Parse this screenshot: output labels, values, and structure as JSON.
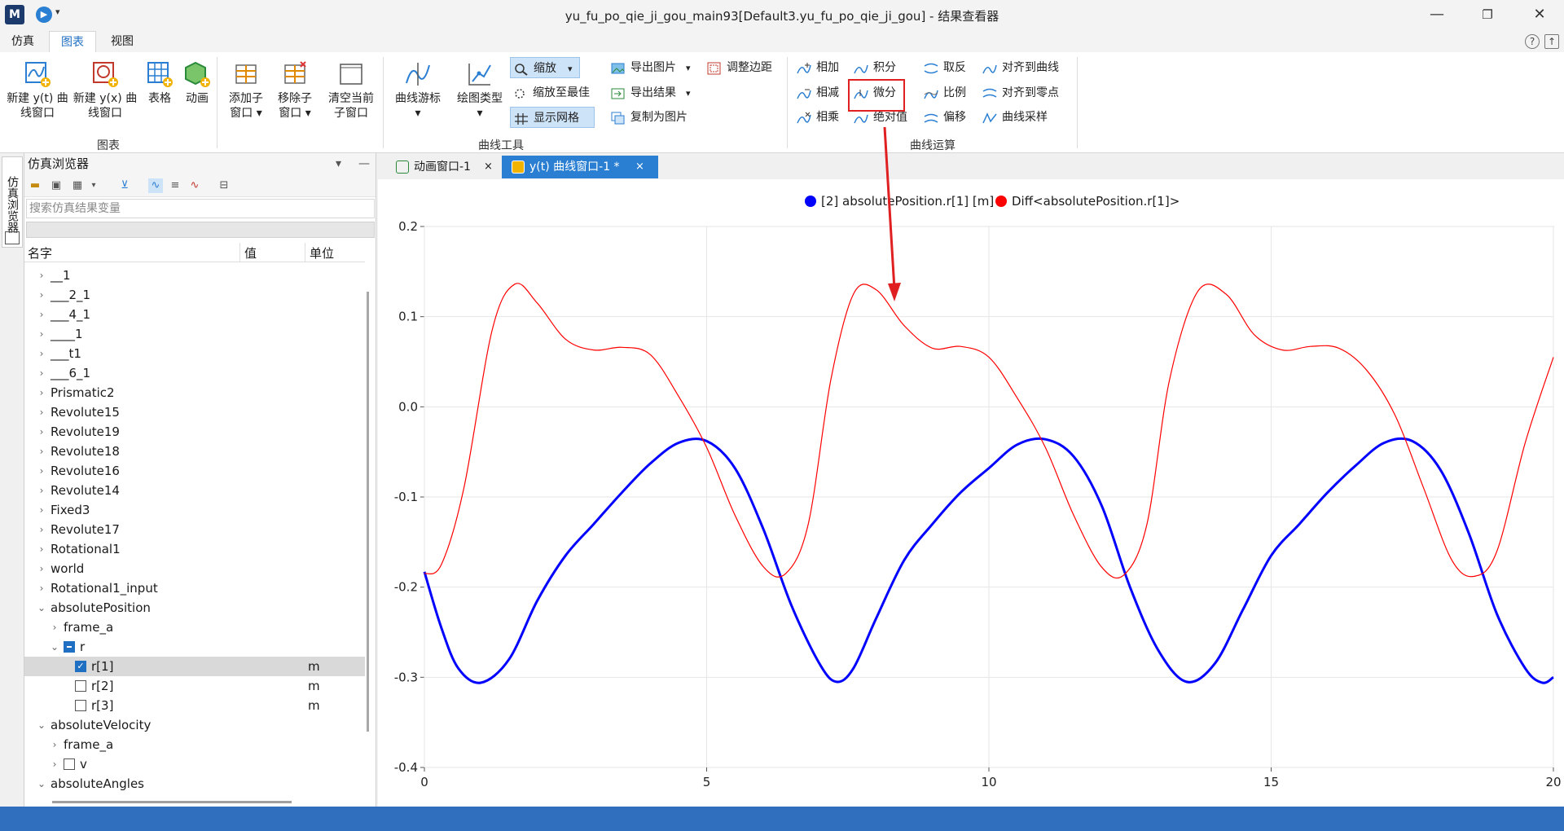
{
  "window": {
    "title": "yu_fu_po_qie_ji_gou_main93[Default3.yu_fu_po_qie_ji_gou] - 结果查看器",
    "app_logo": "M",
    "controls": [
      "minimize-icon",
      "restore-icon",
      "close-icon"
    ]
  },
  "menu": {
    "items": [
      "仿真",
      "图表",
      "视图"
    ],
    "active": "图表"
  },
  "ribbon": {
    "chart_group": {
      "label": "图表",
      "buttons": [
        {
          "l1": "新建 y(t) 曲",
          "l2": "线窗口"
        },
        {
          "l1": "新建 y(x) 曲",
          "l2": "线窗口"
        },
        {
          "l1": "表格",
          "l2": ""
        },
        {
          "l1": "动画",
          "l2": ""
        }
      ]
    },
    "window_group": {
      "buttons": [
        {
          "l1": "添加子",
          "l2": "窗口 ▾"
        },
        {
          "l1": "移除子",
          "l2": "窗口 ▾"
        },
        {
          "l1": "清空当前",
          "l2": "子窗口"
        }
      ]
    },
    "curve_tools": {
      "label": "曲线工具",
      "cursor": {
        "l1": "曲线游标",
        "l2": "▾"
      },
      "plot_type": {
        "l1": "绘图类型",
        "l2": "▾"
      },
      "zoom": "缩放",
      "zoom_best": "缩放至最佳",
      "show_grid": "显示网格",
      "export_image": "导出图片",
      "export_result": "导出结果",
      "copy_image": "复制为图片",
      "adjust_margin": "调整边距"
    },
    "curve_ops": {
      "label": "曲线运算",
      "add": "相加",
      "sub": "相减",
      "mul": "相乘",
      "integral": "积分",
      "diff": "微分",
      "abs": "绝对值",
      "negate": "取反",
      "ratio": "比例",
      "offset": "偏移",
      "align_curve": "对齐到曲线",
      "align_zero": "对齐到零点",
      "sample": "曲线采样"
    }
  },
  "sidebar": {
    "vertical_tab": "仿真浏览器",
    "title": "仿真浏览器",
    "search_placeholder": "搜索仿真结果变量",
    "columns": {
      "name": "名字",
      "value": "值",
      "unit": "单位"
    },
    "tree": [
      {
        "label": "__1",
        "level": 0,
        "chev": "›"
      },
      {
        "label": "___2_1",
        "level": 0,
        "chev": "›"
      },
      {
        "label": "___4_1",
        "level": 0,
        "chev": "›"
      },
      {
        "label": "____1",
        "level": 0,
        "chev": "›"
      },
      {
        "label": "___t1",
        "level": 0,
        "chev": "›"
      },
      {
        "label": "___6_1",
        "level": 0,
        "chev": "›"
      },
      {
        "label": "Prismatic2",
        "level": 0,
        "chev": "›"
      },
      {
        "label": "Revolute15",
        "level": 0,
        "chev": "›"
      },
      {
        "label": "Revolute19",
        "level": 0,
        "chev": "›"
      },
      {
        "label": "Revolute18",
        "level": 0,
        "chev": "›"
      },
      {
        "label": "Revolute16",
        "level": 0,
        "chev": "›"
      },
      {
        "label": "Revolute14",
        "level": 0,
        "chev": "›"
      },
      {
        "label": "Fixed3",
        "level": 0,
        "chev": "›"
      },
      {
        "label": "Revolute17",
        "level": 0,
        "chev": "›"
      },
      {
        "label": "Rotational1",
        "level": 0,
        "chev": "›"
      },
      {
        "label": "world",
        "level": 0,
        "chev": "›"
      },
      {
        "label": "Rotational1_input",
        "level": 0,
        "chev": "›"
      },
      {
        "label": "absolutePosition",
        "level": 0,
        "chev": "⌄"
      },
      {
        "label": "frame_a",
        "level": 1,
        "chev": "›"
      },
      {
        "label": "r",
        "level": 1,
        "chev": "⌄",
        "cb": "part"
      },
      {
        "label": "r[1]",
        "level": 2,
        "cb": "on",
        "unit": "m",
        "selected": true
      },
      {
        "label": "r[2]",
        "level": 2,
        "cb": "off",
        "unit": "m"
      },
      {
        "label": "r[3]",
        "level": 2,
        "cb": "off",
        "unit": "m"
      },
      {
        "label": "absoluteVelocity",
        "level": 0,
        "chev": "⌄"
      },
      {
        "label": "frame_a",
        "level": 1,
        "chev": "›"
      },
      {
        "label": "v",
        "level": 1,
        "chev": "›",
        "cb": "off"
      },
      {
        "label": "absoluteAngles",
        "level": 0,
        "chev": "⌄"
      }
    ]
  },
  "tabs": [
    {
      "label": "动画窗口-1",
      "close": "×",
      "active": false
    },
    {
      "label": "y(t) 曲线窗口-1 *",
      "close": "×",
      "active": true
    }
  ],
  "colors": {
    "accent": "#2b7fd3",
    "series1": "#0000ff",
    "series2": "#ff0000",
    "highlight": "#e02020"
  },
  "chart_data": {
    "type": "line",
    "xlim": [
      0,
      20
    ],
    "ylim": [
      -0.4,
      0.2
    ],
    "xticks": [
      0,
      5,
      10,
      15,
      20
    ],
    "yticks": [
      -0.4,
      -0.3,
      -0.2,
      -0.1,
      0.0,
      0.1,
      0.2
    ],
    "ytick_labels": [
      "-0.4",
      "-0.3",
      "-0.2",
      "-0.1",
      "0.0",
      "0.1",
      "0.2"
    ],
    "grid": true,
    "legend_position": "top-center",
    "series": [
      {
        "name": "[2] absolutePosition.r[1] [m]",
        "color": "#0000ff",
        "x": [
          0,
          0.3,
          0.6,
          1.0,
          1.5,
          2.0,
          2.5,
          3.0,
          3.5,
          4.0,
          4.5,
          5.0,
          5.5,
          6.0,
          6.5,
          7.0,
          7.3,
          7.6,
          8.0,
          8.5,
          9.0,
          9.5,
          10.0,
          10.5,
          11.0,
          11.5,
          12.0,
          12.5,
          13.0,
          13.5,
          14.0,
          14.5,
          15.0,
          15.5,
          16.0,
          16.5,
          17.0,
          17.5,
          18.0,
          18.5,
          19.0,
          19.5,
          19.8,
          20.0
        ],
        "y": [
          -0.183,
          -0.245,
          -0.29,
          -0.306,
          -0.28,
          -0.215,
          -0.165,
          -0.13,
          -0.095,
          -0.063,
          -0.04,
          -0.038,
          -0.068,
          -0.135,
          -0.22,
          -0.285,
          -0.305,
          -0.29,
          -0.235,
          -0.17,
          -0.13,
          -0.095,
          -0.068,
          -0.042,
          -0.036,
          -0.055,
          -0.11,
          -0.2,
          -0.27,
          -0.305,
          -0.285,
          -0.225,
          -0.165,
          -0.13,
          -0.095,
          -0.065,
          -0.04,
          -0.038,
          -0.07,
          -0.14,
          -0.23,
          -0.29,
          -0.306,
          -0.3
        ]
      },
      {
        "name": "Diff<absolutePosition.r[1]>",
        "color": "#ff0000",
        "x": [
          0,
          0.3,
          0.7,
          1.2,
          1.6,
          2.0,
          2.5,
          3.0,
          3.5,
          4.0,
          4.5,
          5.0,
          5.5,
          6.0,
          6.4,
          6.8,
          7.2,
          7.6,
          8.0,
          8.5,
          9.0,
          9.5,
          10.0,
          10.5,
          11.0,
          11.5,
          12.0,
          12.4,
          12.8,
          13.2,
          13.7,
          14.2,
          14.7,
          15.2,
          15.7,
          16.2,
          16.7,
          17.2,
          17.7,
          18.2,
          18.6,
          19.0,
          19.5,
          20.0
        ],
        "y": [
          -0.185,
          -0.175,
          -0.09,
          0.085,
          0.136,
          0.115,
          0.075,
          0.063,
          0.066,
          0.058,
          0.012,
          -0.045,
          -0.12,
          -0.177,
          -0.185,
          -0.13,
          0.03,
          0.125,
          0.13,
          0.09,
          0.065,
          0.067,
          0.055,
          0.01,
          -0.045,
          -0.12,
          -0.178,
          -0.186,
          -0.13,
          0.03,
          0.128,
          0.125,
          0.08,
          0.063,
          0.067,
          0.065,
          0.04,
          -0.01,
          -0.09,
          -0.17,
          -0.188,
          -0.16,
          -0.04,
          0.055
        ]
      }
    ]
  }
}
